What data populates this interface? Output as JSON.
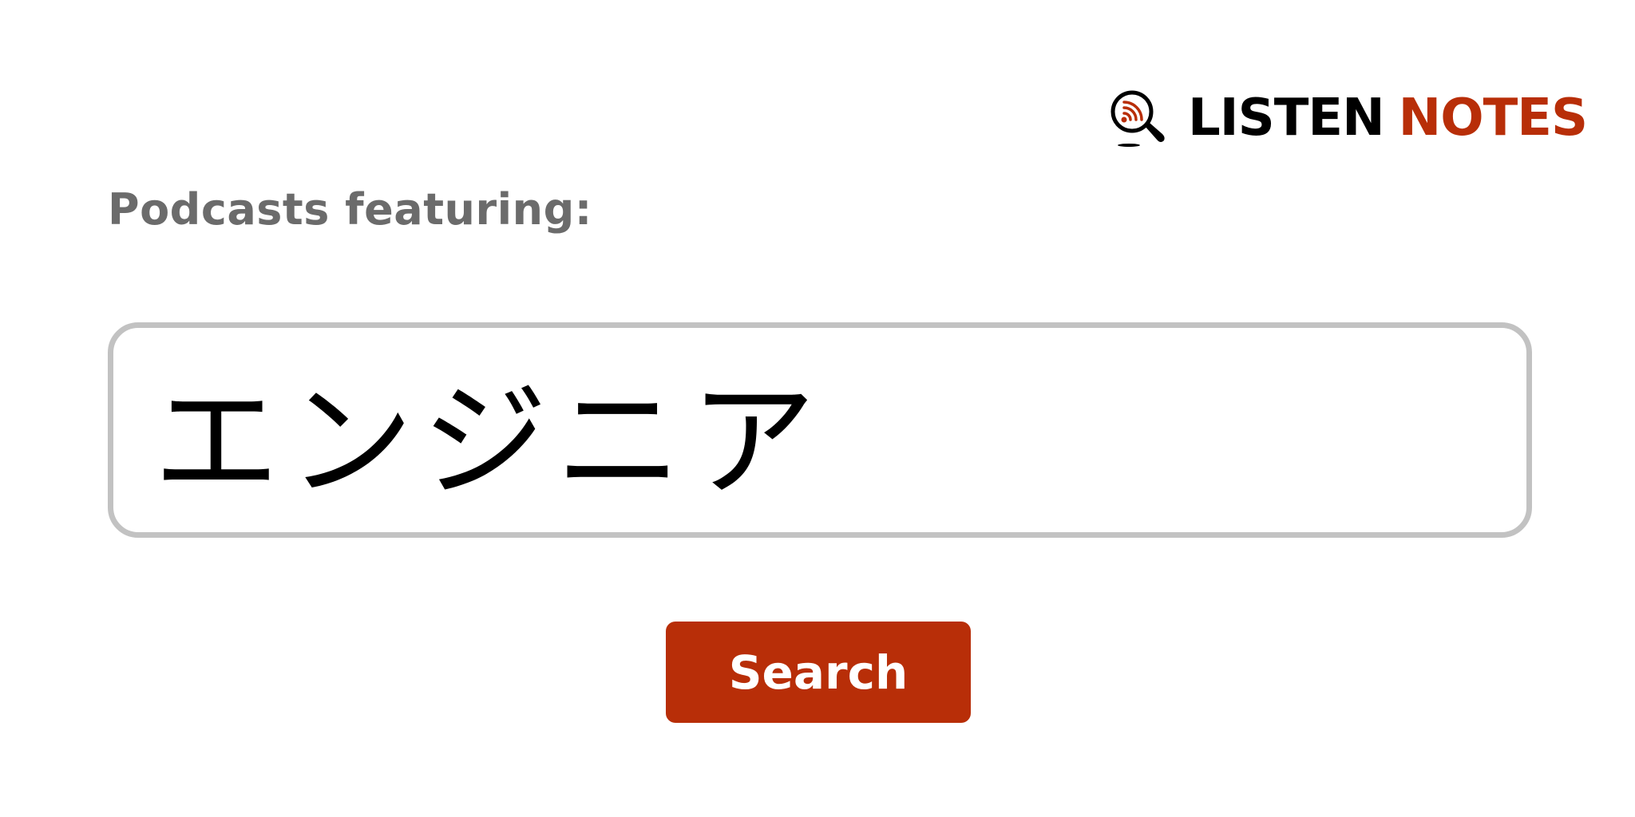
{
  "logo": {
    "word_1": "LISTEN",
    "word_2": "NOTES",
    "icon": "magnifier-podcast-icon",
    "colors": {
      "primary": "#000000",
      "accent": "#b82e08"
    }
  },
  "heading": "Podcasts featuring:",
  "search": {
    "value": "エンジニア"
  },
  "button": {
    "label": "Search",
    "color": "#b82e08"
  }
}
